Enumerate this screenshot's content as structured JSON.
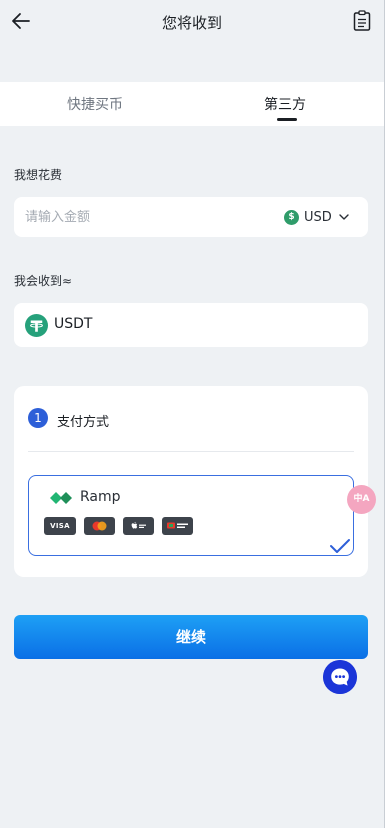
{
  "header": {
    "title": "您将收到",
    "back_icon": "arrow-left-icon",
    "record_icon": "clipboard-list-icon"
  },
  "tabs": [
    {
      "label": "快捷买币",
      "active": false
    },
    {
      "label": "第三方",
      "active": true
    }
  ],
  "spend": {
    "label": "我想花费",
    "placeholder": "请输入金额",
    "value": "",
    "currency": "USD",
    "currency_icon_glyph": "$"
  },
  "receive": {
    "label": "我会收到≈",
    "asset": "USDT",
    "asset_icon": "tether-icon"
  },
  "payment": {
    "step": "1",
    "title": "支付方式",
    "selected_provider": {
      "name": "Ramp",
      "methods": [
        "VISA",
        "mastercard",
        "Apple Pay",
        "Bank Card"
      ],
      "selected": true
    }
  },
  "translate_fab": {
    "glyph": "中A",
    "icon": "translate-icon"
  },
  "continue_button": {
    "label": "继续"
  },
  "colors": {
    "accent": "#0a6fe6",
    "selection_border": "#3a6fe0",
    "step_badge": "#2d5fd8",
    "usdt_green": "#26a17b",
    "chat_fab": "#1b35d8"
  }
}
